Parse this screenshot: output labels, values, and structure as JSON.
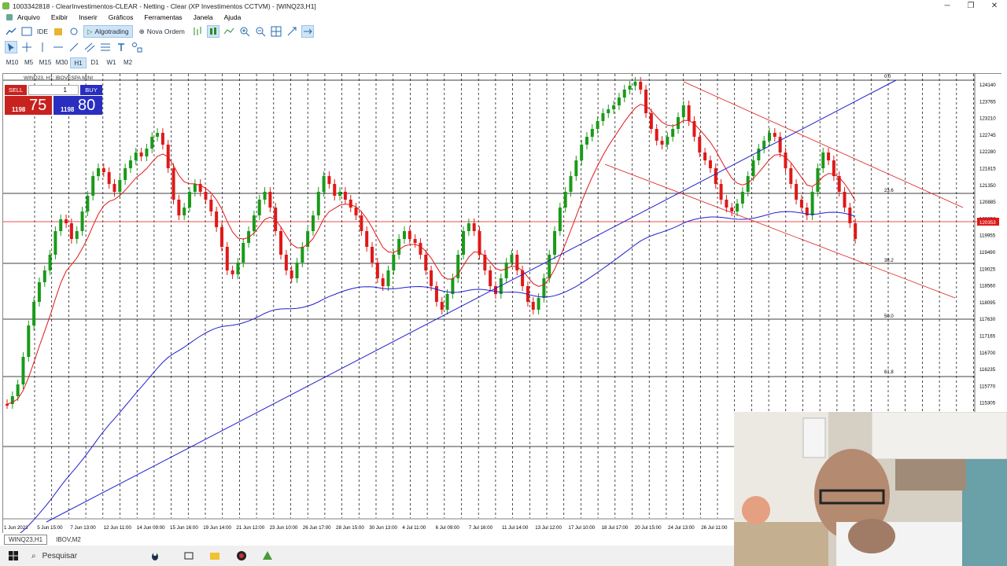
{
  "window": {
    "title": "1003342818 - ClearInvestimentos-CLEAR - Netting - Clear (XP Investimentos CCTVM) - [WINQ23,H1]"
  },
  "menu": [
    "Arquivo",
    "Exibir",
    "Inserir",
    "Gráficos",
    "Ferramentas",
    "Janela",
    "Ajuda"
  ],
  "toolbar": {
    "ide": "IDE",
    "algotrading": "Algotrading",
    "nova_ordem": "Nova Ordem"
  },
  "timeframes": [
    "M10",
    "M5",
    "M15",
    "M30",
    "H1",
    "D1",
    "W1",
    "M2"
  ],
  "active_timeframe": "H1",
  "chart": {
    "symbol_label": "WINQ23, H1:  IBOVESPA MINI",
    "trade_panel": {
      "sell_label": "SELL",
      "buy_label": "BUY",
      "lot": "1",
      "sell_price_minor": "1198",
      "sell_price_major": "75",
      "buy_price_minor": "1198",
      "buy_price_major": "80"
    },
    "price_labels": [
      "124140",
      "123765",
      "123210",
      "122745",
      "122280",
      "121815",
      "121350",
      "120885",
      "120353",
      "119955",
      "119490",
      "119025",
      "118560",
      "118095",
      "117630",
      "117165",
      "116700",
      "116235",
      "115770",
      "115305"
    ],
    "current_price_label": "120353",
    "fib_labels": [
      "0.0",
      "23.6",
      "38.2",
      "50.0",
      "61.8"
    ],
    "date_labels": [
      "1 Jun 2023",
      "5 Jun 15:00",
      "7 Jun 13:00",
      "12 Jun 11:00",
      "14 Jun 09:00",
      "15 Jun 16:00",
      "19 Jun 14:00",
      "21 Jun 12:00",
      "23 Jun 10:00",
      "26 Jun 17:00",
      "28 Jun 15:00",
      "30 Jun 13:00",
      "4 Jul 11:00",
      "6 Jul 09:00",
      "7 Jul 16:00",
      "11 Jul 14:00",
      "13 Jul 12:00",
      "17 Jul 10:00",
      "18 Jul 17:00",
      "20 Jul 15:00",
      "24 Jul 13:00",
      "26 Jul 11:00"
    ]
  },
  "tabs": [
    "WINQ23,H1",
    "IBOV,M2"
  ],
  "taskbar": {
    "search_placeholder": "Pesquisar"
  },
  "colors": {
    "sell": "#c8221f",
    "buy": "#2a2ec0",
    "ma_red": "#e01818",
    "ma_blue": "#2020d0",
    "grid": "#000000"
  }
}
